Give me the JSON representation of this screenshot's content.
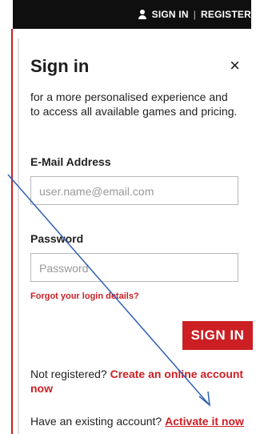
{
  "header": {
    "sign_in_link": "SIGN IN",
    "register_link": "REGISTER"
  },
  "panel": {
    "title": "Sign in",
    "close_glyph": "×",
    "subtitle": "for a more personalised experience and to access all available games and pricing.",
    "email": {
      "label": "E-Mail Address",
      "placeholder": "user.name@email.com"
    },
    "password": {
      "label": "Password",
      "placeholder": "Password"
    },
    "forgot_link": "Forgot your login details?",
    "sign_in_button": "SIGN IN",
    "not_registered_text": "Not registered?",
    "create_account_link": "Create an online account now",
    "existing_account_text": "Have an existing account?",
    "activate_link": "Activate it now"
  },
  "colors": {
    "accent": "#cc1f24",
    "topbar": "#0f0f10",
    "annotation": "#2f5fb0"
  },
  "icons": {
    "user": "user-icon",
    "close": "close-icon"
  }
}
